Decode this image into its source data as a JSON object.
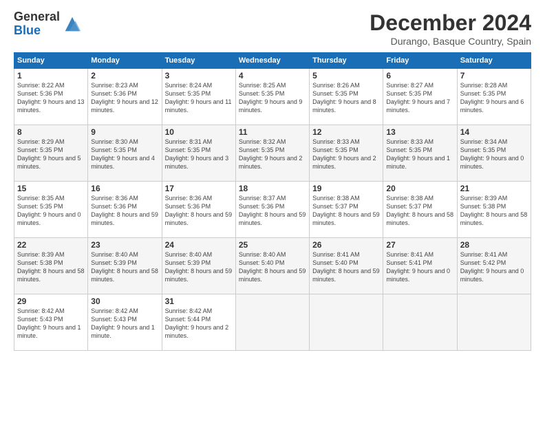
{
  "logo": {
    "line1": "General",
    "line2": "Blue"
  },
  "title": "December 2024",
  "subtitle": "Durango, Basque Country, Spain",
  "days_of_week": [
    "Sunday",
    "Monday",
    "Tuesday",
    "Wednesday",
    "Thursday",
    "Friday",
    "Saturday"
  ],
  "weeks": [
    [
      {
        "day": "1",
        "sunrise": "8:22 AM",
        "sunset": "5:36 PM",
        "daylight": "9 hours and 13 minutes."
      },
      {
        "day": "2",
        "sunrise": "8:23 AM",
        "sunset": "5:36 PM",
        "daylight": "9 hours and 12 minutes."
      },
      {
        "day": "3",
        "sunrise": "8:24 AM",
        "sunset": "5:35 PM",
        "daylight": "9 hours and 11 minutes."
      },
      {
        "day": "4",
        "sunrise": "8:25 AM",
        "sunset": "5:35 PM",
        "daylight": "9 hours and 9 minutes."
      },
      {
        "day": "5",
        "sunrise": "8:26 AM",
        "sunset": "5:35 PM",
        "daylight": "9 hours and 8 minutes."
      },
      {
        "day": "6",
        "sunrise": "8:27 AM",
        "sunset": "5:35 PM",
        "daylight": "9 hours and 7 minutes."
      },
      {
        "day": "7",
        "sunrise": "8:28 AM",
        "sunset": "5:35 PM",
        "daylight": "9 hours and 6 minutes."
      }
    ],
    [
      {
        "day": "8",
        "sunrise": "8:29 AM",
        "sunset": "5:35 PM",
        "daylight": "9 hours and 5 minutes."
      },
      {
        "day": "9",
        "sunrise": "8:30 AM",
        "sunset": "5:35 PM",
        "daylight": "9 hours and 4 minutes."
      },
      {
        "day": "10",
        "sunrise": "8:31 AM",
        "sunset": "5:35 PM",
        "daylight": "9 hours and 3 minutes."
      },
      {
        "day": "11",
        "sunrise": "8:32 AM",
        "sunset": "5:35 PM",
        "daylight": "9 hours and 2 minutes."
      },
      {
        "day": "12",
        "sunrise": "8:33 AM",
        "sunset": "5:35 PM",
        "daylight": "9 hours and 2 minutes."
      },
      {
        "day": "13",
        "sunrise": "8:33 AM",
        "sunset": "5:35 PM",
        "daylight": "9 hours and 1 minute."
      },
      {
        "day": "14",
        "sunrise": "8:34 AM",
        "sunset": "5:35 PM",
        "daylight": "9 hours and 0 minutes."
      }
    ],
    [
      {
        "day": "15",
        "sunrise": "8:35 AM",
        "sunset": "5:35 PM",
        "daylight": "9 hours and 0 minutes."
      },
      {
        "day": "16",
        "sunrise": "8:36 AM",
        "sunset": "5:36 PM",
        "daylight": "8 hours and 59 minutes."
      },
      {
        "day": "17",
        "sunrise": "8:36 AM",
        "sunset": "5:36 PM",
        "daylight": "8 hours and 59 minutes."
      },
      {
        "day": "18",
        "sunrise": "8:37 AM",
        "sunset": "5:36 PM",
        "daylight": "8 hours and 59 minutes."
      },
      {
        "day": "19",
        "sunrise": "8:38 AM",
        "sunset": "5:37 PM",
        "daylight": "8 hours and 59 minutes."
      },
      {
        "day": "20",
        "sunrise": "8:38 AM",
        "sunset": "5:37 PM",
        "daylight": "8 hours and 58 minutes."
      },
      {
        "day": "21",
        "sunrise": "8:39 AM",
        "sunset": "5:38 PM",
        "daylight": "8 hours and 58 minutes."
      }
    ],
    [
      {
        "day": "22",
        "sunrise": "8:39 AM",
        "sunset": "5:38 PM",
        "daylight": "8 hours and 58 minutes."
      },
      {
        "day": "23",
        "sunrise": "8:40 AM",
        "sunset": "5:39 PM",
        "daylight": "8 hours and 58 minutes."
      },
      {
        "day": "24",
        "sunrise": "8:40 AM",
        "sunset": "5:39 PM",
        "daylight": "8 hours and 59 minutes."
      },
      {
        "day": "25",
        "sunrise": "8:40 AM",
        "sunset": "5:40 PM",
        "daylight": "8 hours and 59 minutes."
      },
      {
        "day": "26",
        "sunrise": "8:41 AM",
        "sunset": "5:40 PM",
        "daylight": "8 hours and 59 minutes."
      },
      {
        "day": "27",
        "sunrise": "8:41 AM",
        "sunset": "5:41 PM",
        "daylight": "9 hours and 0 minutes."
      },
      {
        "day": "28",
        "sunrise": "8:41 AM",
        "sunset": "5:42 PM",
        "daylight": "9 hours and 0 minutes."
      }
    ],
    [
      {
        "day": "29",
        "sunrise": "8:42 AM",
        "sunset": "5:43 PM",
        "daylight": "9 hours and 1 minute."
      },
      {
        "day": "30",
        "sunrise": "8:42 AM",
        "sunset": "5:43 PM",
        "daylight": "9 hours and 1 minute."
      },
      {
        "day": "31",
        "sunrise": "8:42 AM",
        "sunset": "5:44 PM",
        "daylight": "9 hours and 2 minutes."
      },
      null,
      null,
      null,
      null
    ]
  ],
  "labels": {
    "sunrise": "Sunrise:",
    "sunset": "Sunset:",
    "daylight": "Daylight:"
  }
}
